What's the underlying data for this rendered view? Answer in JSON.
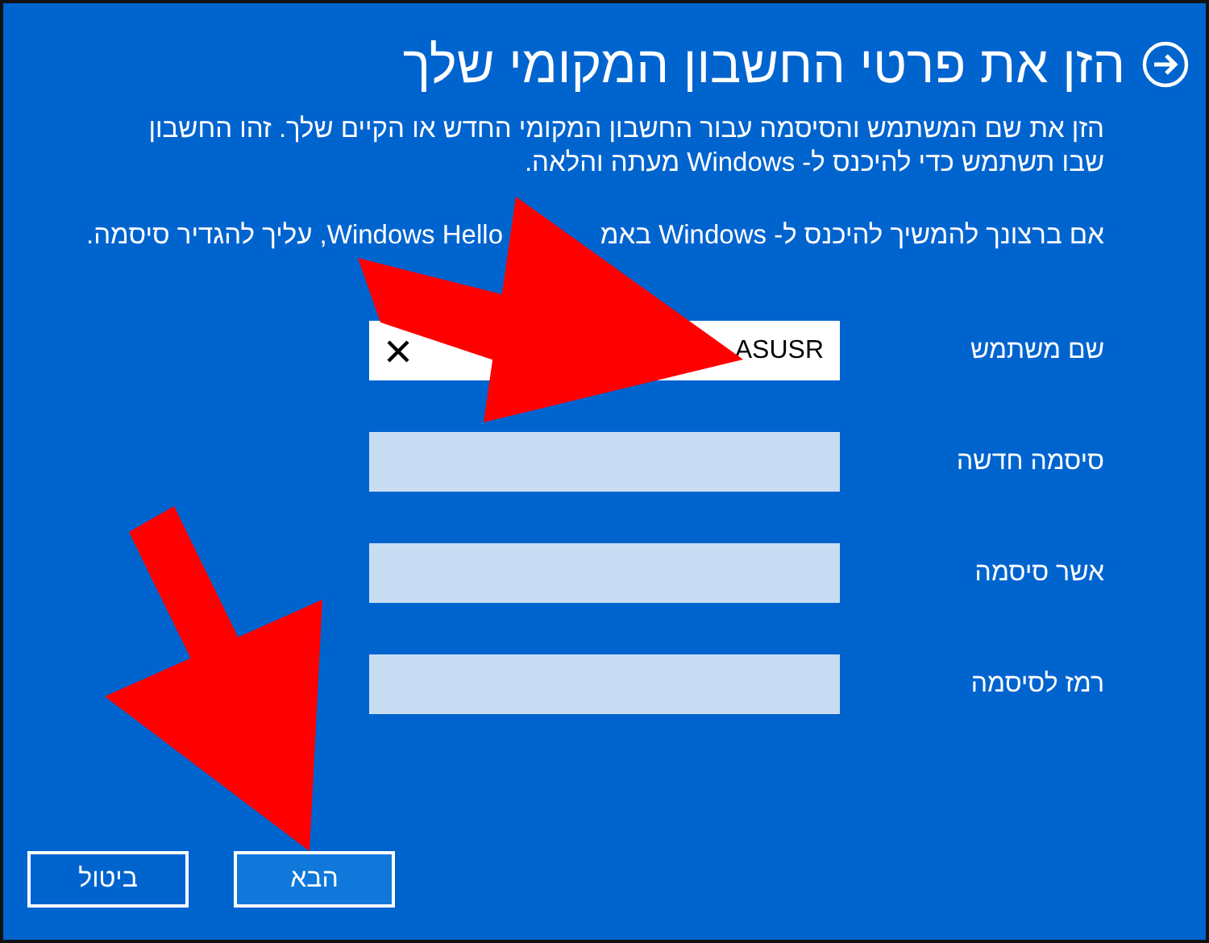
{
  "dialog": {
    "title": "הזן את פרטי החשבון המקומי שלך",
    "paragraphs": [
      {
        "parts": [
          "הזן את שם המשתמש והסיסמה עבור החשבון המקומי החדש או הקיים שלך. זהו החשבון שבו תשתמש כדי להיכנס ל- Windows מעתה והלאה."
        ]
      },
      {
        "parts": [
          "אם ברצונך להמשיך להיכנס ל- Windows באמ",
          "Windows Hello, עליך להגדיר סיסמה."
        ]
      }
    ],
    "fields": [
      {
        "label": "שם משתמש",
        "value": "ASUSR",
        "focused": true
      },
      {
        "label": "סיסמה חדשה",
        "focused": false
      },
      {
        "label": "אשר סיסמה",
        "focused": false
      },
      {
        "label": "רמז לסיסמה",
        "focused": false
      }
    ],
    "buttons": [
      {
        "label": "הבא",
        "kind": "primary"
      },
      {
        "label": "ביטול",
        "kind": "secondary"
      }
    ]
  }
}
